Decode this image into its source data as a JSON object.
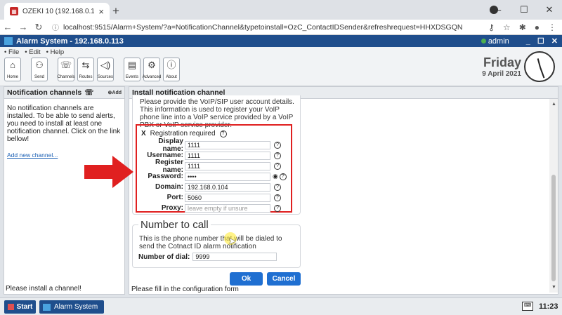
{
  "browser": {
    "tab_title": "OZEKI 10 (192.168.0.113)",
    "url": "localhost:9515/Alarm+System/?a=NotificationChannel&typetoinstall=OzC_ContactIDSender&refreshrequest=HHXDSGQN"
  },
  "app": {
    "title": "Alarm System - 192.168.0.113",
    "user": "admin"
  },
  "menu": [
    "• File",
    "• Edit",
    "• Help"
  ],
  "toolbar": {
    "home": "Home",
    "send": "Send",
    "channels": "Channels",
    "routes": "Routes",
    "sources": "Sources",
    "events": "Events",
    "advanced": "Advanced",
    "about": "About"
  },
  "clock": {
    "day": "Friday",
    "date": "9 April 2021"
  },
  "left_panel": {
    "title": "Notification channels",
    "add_label": "Add",
    "message": "No notification channels are installed. To be able to send alerts, you need to install at least one notification channel. Click on the link bellow!",
    "link": "Add new channel...",
    "status": "Please install a channel!"
  },
  "right_panel": {
    "title": "Install notification channel",
    "intro": "Please provide the VoIP/SIP user account details. This information is used to register your VoIP phone line into a VoIP service provided by a VoIP PBX or VoIP service provider.",
    "registration": {
      "check": "X",
      "label": "Registration required"
    },
    "fields": {
      "display_name": {
        "label": "Display name:",
        "value": "1111"
      },
      "username": {
        "label": "Username:",
        "value": "1111"
      },
      "register_name": {
        "label": "Register name:",
        "value": "1111"
      },
      "password": {
        "label": "Password:",
        "value": "••••"
      },
      "domain": {
        "label": "Domain:",
        "value": "192.168.0.104"
      },
      "port": {
        "label": "Port:",
        "value": "5060"
      },
      "proxy": {
        "label": "Proxy:",
        "placeholder": "leave empty if unsure"
      }
    },
    "number_section": {
      "title": "Number to call",
      "desc": "This is the phone number that will be dialed to send the Cotnact ID alarm notification",
      "dial_label": "Number of dial:",
      "dial_value": "9999"
    },
    "ok": "Ok",
    "cancel": "Cancel",
    "status": "Please fill in the configuration form"
  },
  "taskbar": {
    "start": "Start",
    "task": "Alarm System",
    "time": "11:23"
  },
  "colors": {
    "accent": "#1f6fd1",
    "appbar": "#1f4e8c",
    "highlight_box": "#e02020",
    "arrow": "#e02020"
  }
}
